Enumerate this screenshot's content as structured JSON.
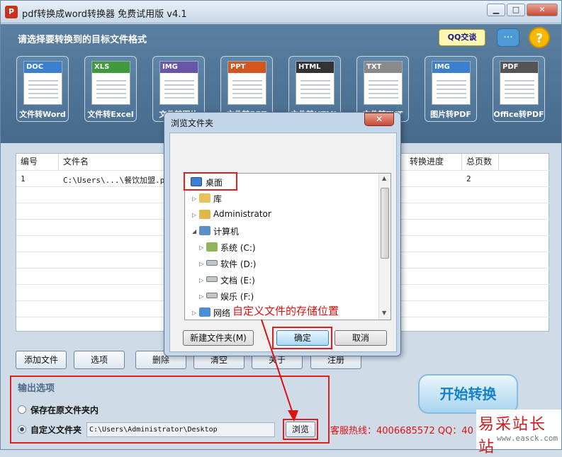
{
  "window": {
    "title": "pdf转换成word转换器 免费试用版 v4.1",
    "icon": "pdf-app-icon",
    "min": "▁",
    "max": "□",
    "close": "✕"
  },
  "header": {
    "title": "请选择要转换到的目标文件格式",
    "qq_label": "QQ交谈",
    "chat_icon": "chat-bubble-icon",
    "help_icon": "help-icon",
    "help_glyph": "?",
    "chat_glyph": "···"
  },
  "formats": [
    {
      "tag": "DOC",
      "label": "文件转Word",
      "color": "#3b7fcf"
    },
    {
      "tag": "XLS",
      "label": "文件转Excel",
      "color": "#3e9a3a"
    },
    {
      "tag": "IMG",
      "label": "文件转图片",
      "color": "#6a56a8"
    },
    {
      "tag": "PPT",
      "label": "文件转PPT",
      "color": "#d2561e"
    },
    {
      "tag": "HTML",
      "label": "文件转HTML",
      "color": "#333333"
    },
    {
      "tag": "TXT",
      "label": "文件转TXT",
      "color": "#8a8a8a"
    },
    {
      "tag": "IMG",
      "label": "图片转PDF",
      "color": "#3b7fcf"
    },
    {
      "tag": "PDF",
      "label": "Office转PDF",
      "color": "#555555"
    }
  ],
  "table": {
    "columns": [
      "编号",
      "文件名",
      "转换进度",
      "总页数"
    ],
    "rows": [
      {
        "no": "1",
        "name": "C:\\Users\\...\\餐饮加盟.pd",
        "progress": "",
        "pages": "2"
      }
    ]
  },
  "buttons": {
    "add": "添加文件",
    "options": "选项",
    "delete": "删除",
    "clear": "清空",
    "about": "关于",
    "register": "注册",
    "browse": "浏览",
    "start": "开始转换"
  },
  "output": {
    "title": "输出选项",
    "opt1": "保存在原文件夹内",
    "opt2": "自定义文件夹",
    "path": "C:\\Users\\Administrator\\Desktop",
    "selected": "opt2"
  },
  "hotline": "客服热线：4006685572 QQ：40",
  "watermark": {
    "cn": "易采站长站",
    "url": "www.easck.com"
  },
  "dialog": {
    "title": "浏览文件夹",
    "close": "✕",
    "tree": [
      {
        "label": "桌面",
        "icon": "desktop-icon",
        "level": 0
      },
      {
        "label": "库",
        "icon": "library-icon",
        "level": 1
      },
      {
        "label": "Administrator",
        "icon": "user-folder-icon",
        "level": 1
      },
      {
        "label": "计算机",
        "icon": "computer-icon",
        "level": 1
      },
      {
        "label": "系统 (C:)",
        "icon": "drive-icon",
        "level": 2
      },
      {
        "label": "软件 (D:)",
        "icon": "drive-icon",
        "level": 2
      },
      {
        "label": "文档 (E:)",
        "icon": "drive-icon",
        "level": 2
      },
      {
        "label": "娱乐 (F:)",
        "icon": "drive-icon",
        "level": 2
      },
      {
        "label": "网络",
        "icon": "network-icon",
        "level": 1
      }
    ],
    "new_folder": "新建文件夹(M)",
    "ok": "确定",
    "cancel": "取消"
  },
  "annotation": "自定义文件的存储位置"
}
